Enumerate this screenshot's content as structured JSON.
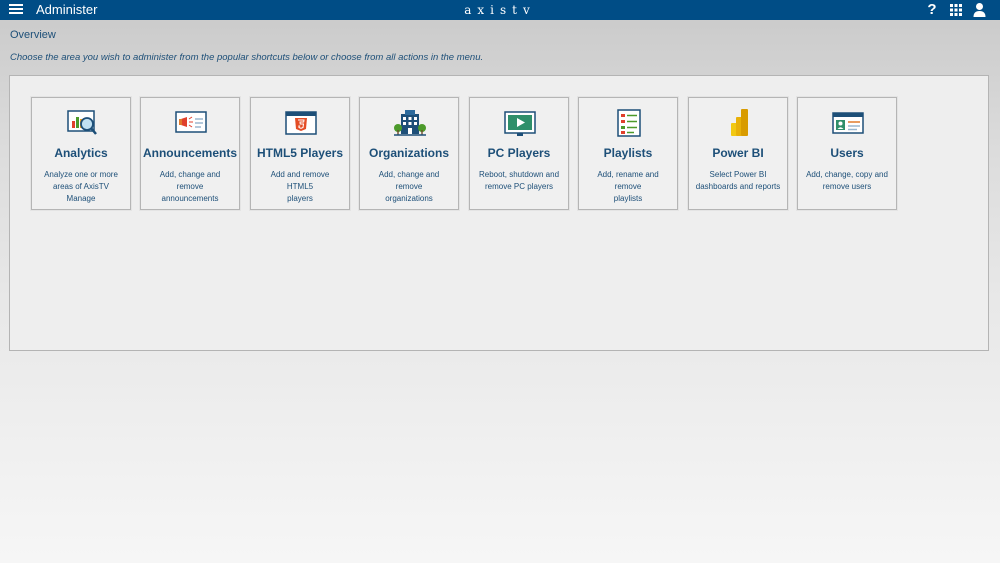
{
  "header": {
    "menu_icon": "hamburger-menu-icon",
    "title": "Administer",
    "logo": "axistv",
    "icons": [
      "help-icon",
      "apps-grid-icon",
      "user-icon"
    ],
    "help_glyph": "?"
  },
  "overview": {
    "title": "Overview",
    "subtitle": "Choose the area you wish to administer from the popular shortcuts below or choose from all actions in the menu."
  },
  "tiles": [
    {
      "title": "Analytics",
      "desc_line1": "Analyze one or more",
      "desc_line2": "areas of AxisTV Manage",
      "icon": "analytics-icon"
    },
    {
      "title": "Announcements",
      "desc_line1": "Add, change and remove",
      "desc_line2": "announcements",
      "icon": "announcements-icon"
    },
    {
      "title": "HTML5 Players",
      "desc_line1": "Add and remove HTML5",
      "desc_line2": "players",
      "icon": "html5-icon"
    },
    {
      "title": "Organizations",
      "desc_line1": "Add, change and remove",
      "desc_line2": "organizations",
      "icon": "organizations-icon"
    },
    {
      "title": "PC Players",
      "desc_line1": "Reboot, shutdown and",
      "desc_line2": "remove PC players",
      "icon": "pc-player-icon"
    },
    {
      "title": "Playlists",
      "desc_line1": "Add, rename and remove",
      "desc_line2": "playlists",
      "icon": "playlist-icon"
    },
    {
      "title": "Power BI",
      "desc_line1": "Select Power BI",
      "desc_line2": "dashboards and reports",
      "icon": "power-bi-icon"
    },
    {
      "title": "Users",
      "desc_line1": "Add, change, copy and",
      "desc_line2": "remove users",
      "icon": "users-icon"
    }
  ],
  "colors": {
    "header_bg": "#004d86",
    "text_accent": "#1d4f78",
    "power_bi_yellow": "#f2c811"
  }
}
